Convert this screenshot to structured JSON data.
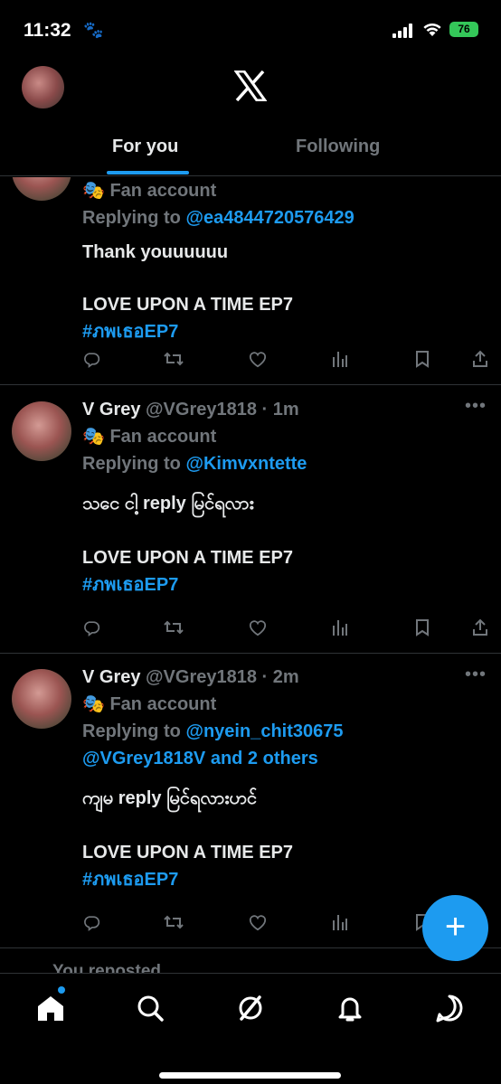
{
  "status_bar": {
    "time": "11:32",
    "battery": "76"
  },
  "header": {
    "tabs": [
      {
        "label": "For you"
      },
      {
        "label": "Following"
      }
    ]
  },
  "posts": [
    {
      "badge": "Fan account",
      "replying_prefix": "Replying to",
      "replying_handle": "@ea4844720576429",
      "text_line1": "Thank youuuuuu",
      "text_line2": "LOVE UPON A TIME EP7",
      "hashtag": "#ภพเธอEP7"
    },
    {
      "name": "V Grey",
      "handle": "@VGrey1818",
      "time": "· 1m",
      "badge": "Fan account",
      "replying_prefix": "Replying to",
      "replying_handle": "@Kimvxntette",
      "text_line1": "သငေ ငါ့ reply မြင်ရလား",
      "text_line2": "LOVE UPON A TIME EP7",
      "hashtag": "#ภพเธอEP7"
    },
    {
      "name": "V Grey",
      "handle": "@VGrey1818",
      "time": "· 2m",
      "badge": "Fan account",
      "replying_prefix": "Replying to",
      "replying_handle": "@nyein_chit30675",
      "replying_more": "@VGrey1818V and 2 others",
      "text_line1": "ကျမ reply မြင်ရလားဟင်",
      "text_line2": "LOVE UPON A TIME EP7",
      "hashtag": "#ภพเธอEP7"
    }
  ],
  "peek_text": "You reposted",
  "icons": {
    "more": "more-icon",
    "badge": "mask-icon",
    "reply": "reply-icon",
    "repost": "repost-icon",
    "like": "like-icon",
    "views": "views-icon",
    "bookmark": "bookmark-icon",
    "share": "share-icon",
    "compose": "compose-icon"
  },
  "colors": {
    "accent": "#1d9bf0",
    "background": "#000000",
    "muted": "#71767b",
    "battery": "#34c759"
  }
}
